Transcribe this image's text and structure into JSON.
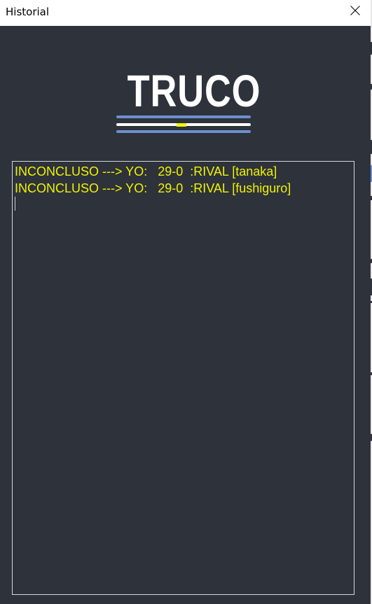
{
  "window": {
    "title": "Historial"
  },
  "icons": {
    "close": "close-icon"
  },
  "logo": {
    "text": "TRUCO",
    "colors": {
      "stripe_blue": "#6d8fd0",
      "stripe_white": "#ffffff",
      "sun": "#f3f500"
    }
  },
  "history": {
    "lines": [
      "INCONCLUSO ---> YO:   29-0  :RIVAL [tanaka]",
      "INCONCLUSO ---> YO:   29-0  :RIVAL [fushiguro]"
    ],
    "text_color": "#f2f200"
  },
  "colors": {
    "background": "#2d323b",
    "titlebar": "#ffffff"
  }
}
